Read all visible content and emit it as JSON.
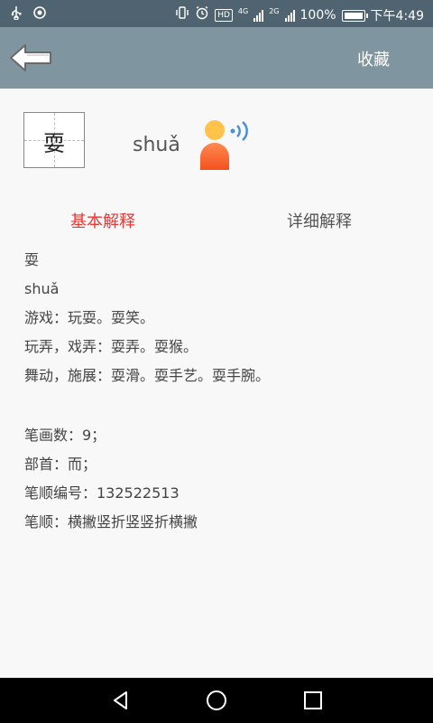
{
  "status_bar": {
    "battery_percent": "100%",
    "time": "下午4:49",
    "network_1": "4G",
    "network_2": "2G",
    "hd_label": "HD"
  },
  "toolbar": {
    "favorite_label": "收藏"
  },
  "character": {
    "hanzi": "耍",
    "pinyin": "shuǎ"
  },
  "tabs": {
    "basic": "基本解释",
    "detail": "详细解释"
  },
  "definition": {
    "lines": [
      "耍",
      "shuǎ",
      "游戏：玩耍。耍笑。",
      "玩弄，戏弄：耍弄。耍猴。",
      "舞动，施展：耍滑。耍手艺。耍手腕。"
    ],
    "info_lines": [
      "笔画数：9；",
      "部首：而；",
      "笔顺编号：132522513",
      "笔顺：横撇竖折竖竖折横撇"
    ]
  },
  "colors": {
    "status_bar": "#4f6470",
    "app_bar": "#7f959f",
    "active_tab": "#e53935",
    "inactive_tab": "#555555",
    "background": "#f8f8f8"
  }
}
